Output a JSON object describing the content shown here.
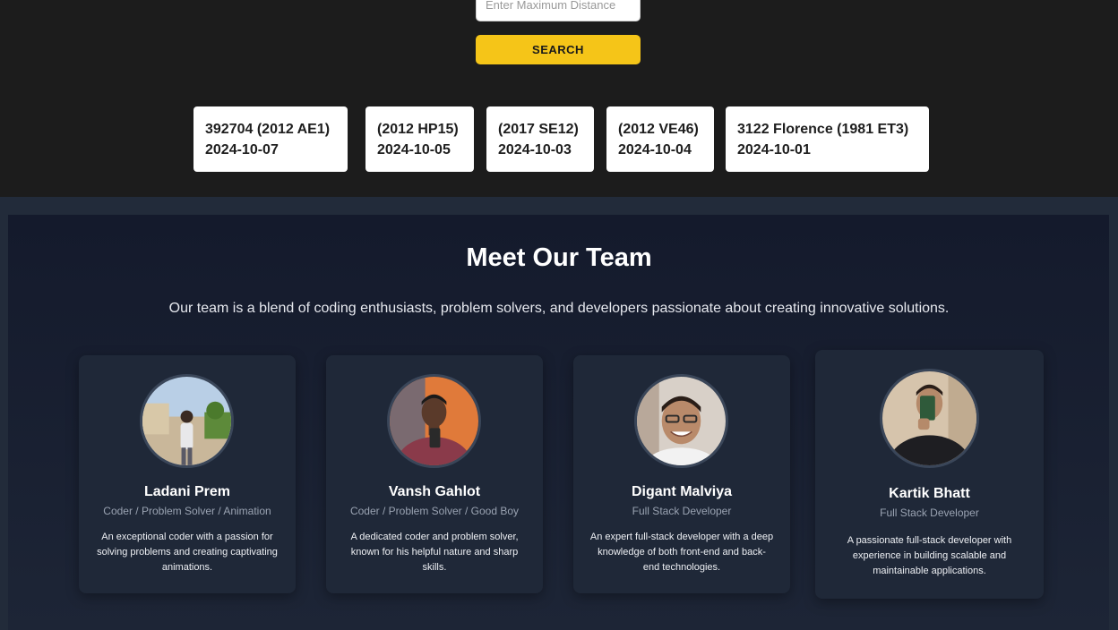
{
  "search": {
    "distance_placeholder": "Enter Maximum Distance",
    "button_label": "SEARCH"
  },
  "asteroids": [
    {
      "name": "392704 (2012 AE1)",
      "date": "2024-10-07"
    },
    {
      "name": "(2012 HP15)",
      "date": "2024-10-05"
    },
    {
      "name": "(2017 SE12)",
      "date": "2024-10-03"
    },
    {
      "name": "(2012 VE46)",
      "date": "2024-10-04"
    },
    {
      "name": "3122 Florence (1981 ET3)",
      "date": "2024-10-01"
    }
  ],
  "team": {
    "title": "Meet Our Team",
    "description": "Our team is a blend of coding enthusiasts, problem solvers, and developers passionate about creating innovative solutions.",
    "members": [
      {
        "name": "Ladani Prem",
        "role": "Coder / Problem Solver / Animation",
        "bio": "An exceptional coder with a passion for solving problems and creating captivating animations."
      },
      {
        "name": "Vansh Gahlot",
        "role": "Coder / Problem Solver / Good Boy",
        "bio": "A dedicated coder and problem solver, known for his helpful nature and sharp skills."
      },
      {
        "name": "Digant Malviya",
        "role": "Full Stack Developer",
        "bio": "An expert full-stack developer with a deep knowledge of both front-end and back-end technologies."
      },
      {
        "name": "Kartik Bhatt",
        "role": "Full Stack Developer",
        "bio": "A passionate full-stack developer with experience in building scalable and maintainable applications."
      }
    ]
  },
  "colors": {
    "accent": "#f5c518",
    "top_background": "#1c1c1c",
    "section_background": "#141a2c",
    "card_background": "#1f2838"
  }
}
